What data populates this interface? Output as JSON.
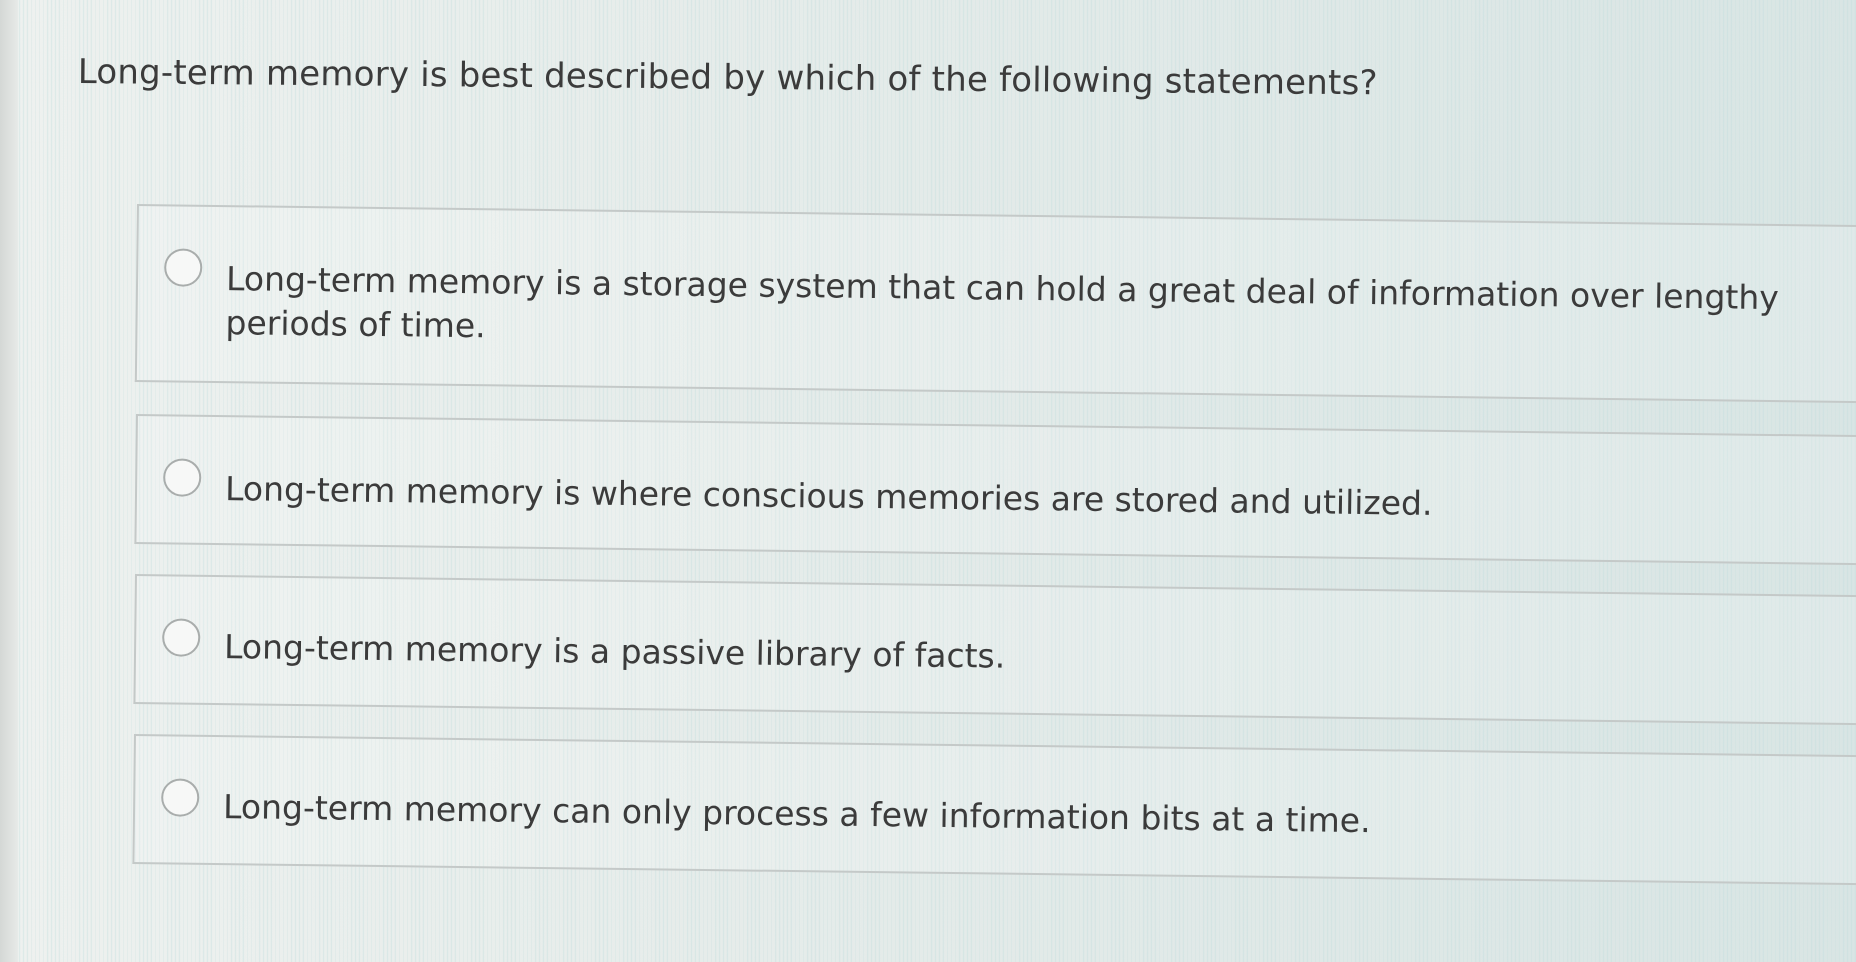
{
  "question": {
    "text": "Long-term memory is best described by which of the following statements?"
  },
  "options": [
    {
      "label": "Long-term memory is a storage system that can hold a great deal of information over lengthy periods of time.",
      "selected": false
    },
    {
      "label": "Long-term memory is where conscious memories are stored and utilized.",
      "selected": false
    },
    {
      "label": "Long-term memory is a passive library of facts.",
      "selected": false
    },
    {
      "label": "Long-term memory can only process a few information bits at a time.",
      "selected": false
    }
  ]
}
